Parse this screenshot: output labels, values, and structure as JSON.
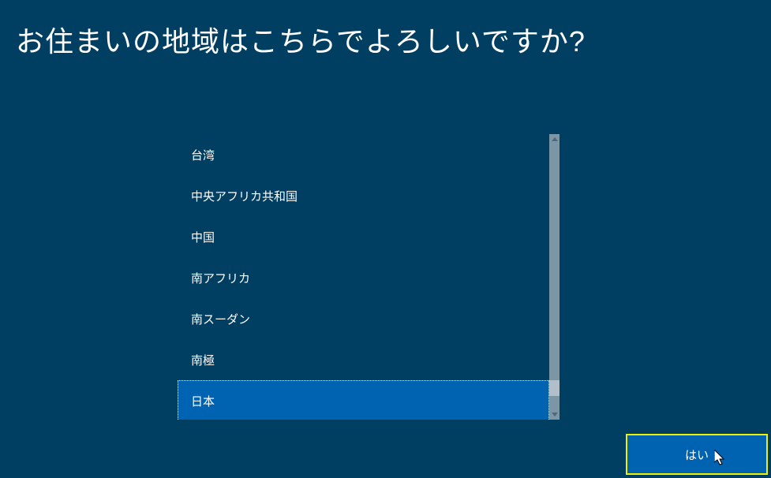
{
  "title": "お住まいの地域はこちらでよろしいですか?",
  "regions": {
    "items": [
      {
        "label": "台湾",
        "selected": false
      },
      {
        "label": "中央アフリカ共和国",
        "selected": false
      },
      {
        "label": "中国",
        "selected": false
      },
      {
        "label": "南アフリカ",
        "selected": false
      },
      {
        "label": "南スーダン",
        "selected": false
      },
      {
        "label": "南極",
        "selected": false
      },
      {
        "label": "日本",
        "selected": true
      }
    ]
  },
  "confirm_button_label": "はい"
}
